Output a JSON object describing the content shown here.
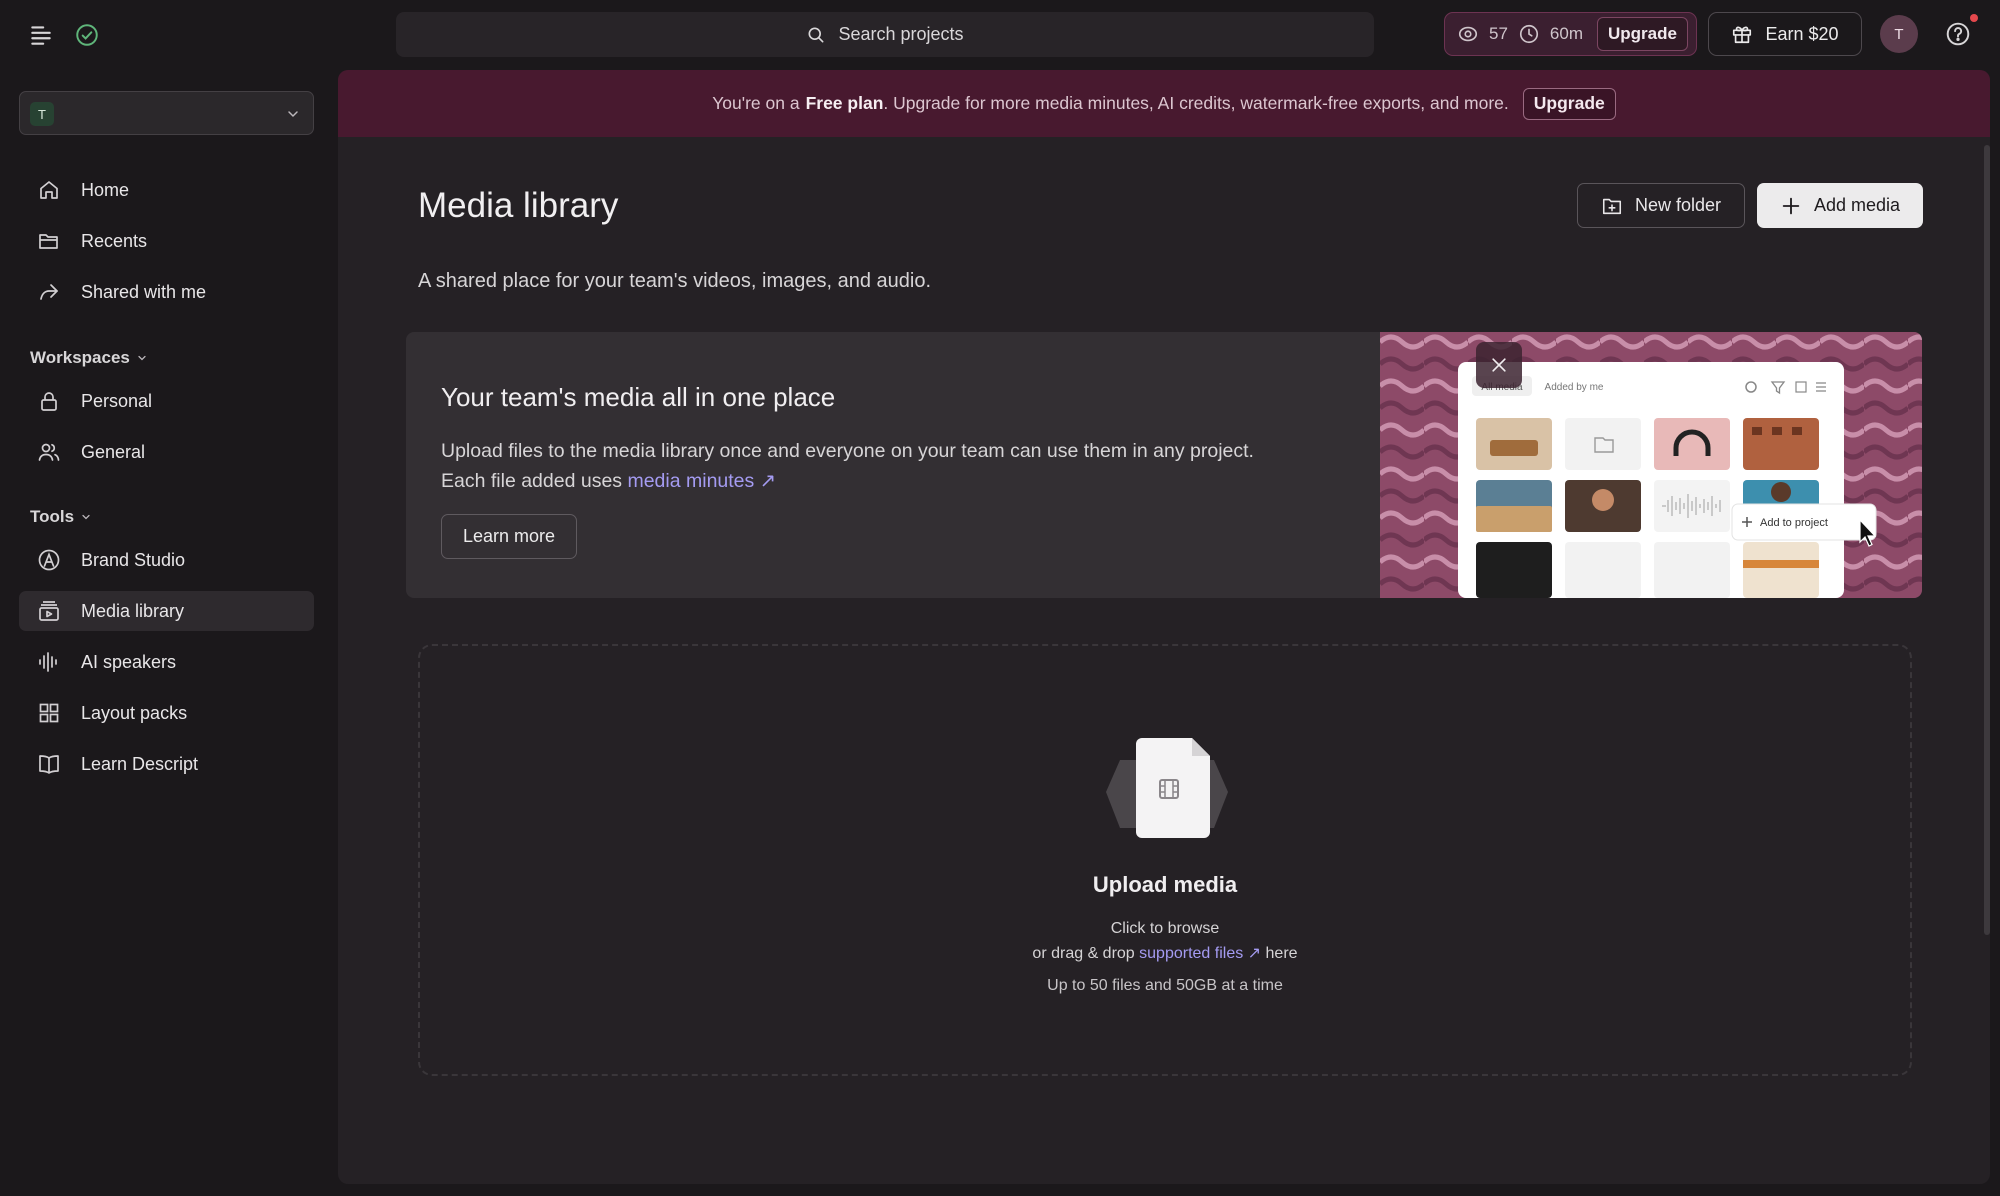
{
  "topbar": {
    "search_placeholder": "Search projects",
    "credits_count": "57",
    "credits_minutes": "60m",
    "upgrade_label": "Upgrade",
    "earn_label": "Earn $20",
    "avatar_initial": "T"
  },
  "sidebar": {
    "workspace_initial": "T",
    "nav": [
      {
        "label": "Home",
        "icon": "home-icon"
      },
      {
        "label": "Recents",
        "icon": "folder-open-icon"
      },
      {
        "label": "Shared with me",
        "icon": "share-arrow-icon"
      }
    ],
    "workspaces_label": "Workspaces",
    "workspaces": [
      {
        "label": "Personal",
        "icon": "lock-icon"
      },
      {
        "label": "General",
        "icon": "users-icon"
      }
    ],
    "tools_label": "Tools",
    "tools": [
      {
        "label": "Brand Studio",
        "icon": "brand-studio-icon"
      },
      {
        "label": "Media library",
        "icon": "media-library-icon",
        "active": true
      },
      {
        "label": "AI speakers",
        "icon": "waveform-icon"
      },
      {
        "label": "Layout packs",
        "icon": "grid-icon"
      },
      {
        "label": "Learn Descript",
        "icon": "book-icon"
      }
    ]
  },
  "banner": {
    "prefix": "You're on a",
    "plan": "Free plan",
    "suffix": ". Upgrade for more media minutes, AI credits, watermark-free exports, and more.",
    "upgrade_label": "Upgrade"
  },
  "main": {
    "title": "Media library",
    "subtitle": "A shared place for your team's videos, images, and audio.",
    "new_folder_label": "New folder",
    "add_media_label": "Add media"
  },
  "promo": {
    "title": "Your team's media all in one place",
    "body_line1": "Upload files to the media library once and everyone on your team can use them in any project.",
    "body_line2_prefix": "Each file added uses",
    "body_link": "media minutes ↗",
    "learn_more_label": "Learn more",
    "preview_tab_all": "All media",
    "preview_tab_mine": "Added by me",
    "preview_add_to_project": "Add to project"
  },
  "upload": {
    "title": "Upload media",
    "click_text": "Click to browse",
    "drag_prefix": "or drag & drop",
    "drag_link": "supported files ↗",
    "drag_suffix": "here",
    "limit_text": "Up to 50 files and 50GB at a time"
  },
  "colors": {
    "background": "#1b181b",
    "panel": "#252125",
    "banner": "#48192f",
    "link": "#a49bf1",
    "credits_border": "#6d3352"
  }
}
